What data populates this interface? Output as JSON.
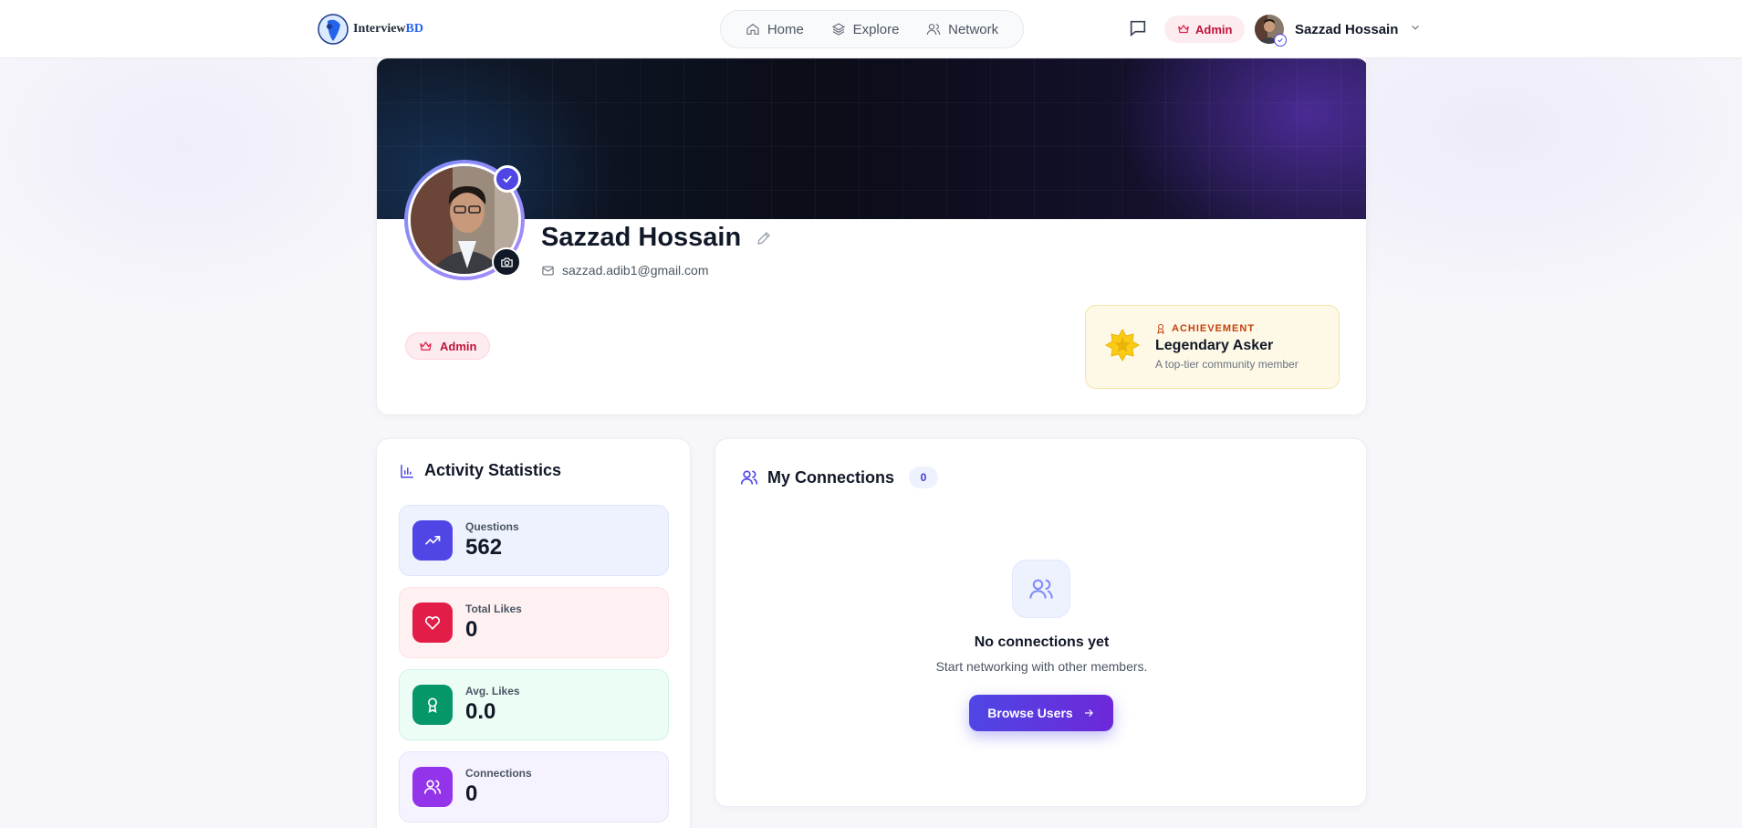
{
  "brand": {
    "name_primary": "Interview",
    "name_accent": "BD"
  },
  "nav": {
    "items": [
      {
        "label": "Home",
        "icon": "home-icon"
      },
      {
        "label": "Explore",
        "icon": "layers-icon"
      },
      {
        "label": "Network",
        "icon": "users-icon"
      }
    ]
  },
  "header": {
    "admin_label": "Admin",
    "user_name": "Sazzad Hossain"
  },
  "profile": {
    "name": "Sazzad Hossain",
    "email": "sazzad.adib1@gmail.com",
    "role": "Admin",
    "achievement": {
      "label": "ACHIEVEMENT",
      "title": "Legendary Asker",
      "subtitle": "A top-tier community member"
    }
  },
  "stats": {
    "title": "Activity Statistics",
    "items": [
      {
        "label": "Questions",
        "value": "562",
        "icon": "trending-up-icon"
      },
      {
        "label": "Total Likes",
        "value": "0",
        "icon": "heart-icon"
      },
      {
        "label": "Avg. Likes",
        "value": "0.0",
        "icon": "award-icon"
      },
      {
        "label": "Connections",
        "value": "0",
        "icon": "users-icon"
      }
    ]
  },
  "connections": {
    "title": "My Connections",
    "count": "0",
    "empty_title": "No connections yet",
    "empty_subtitle": "Start networking with other members.",
    "browse_label": "Browse Users"
  },
  "colors": {
    "accent": "#4f46e5",
    "admin": "#e11d48",
    "likes": "#e11d48",
    "avg": "#059669",
    "connections": "#9333ea"
  }
}
